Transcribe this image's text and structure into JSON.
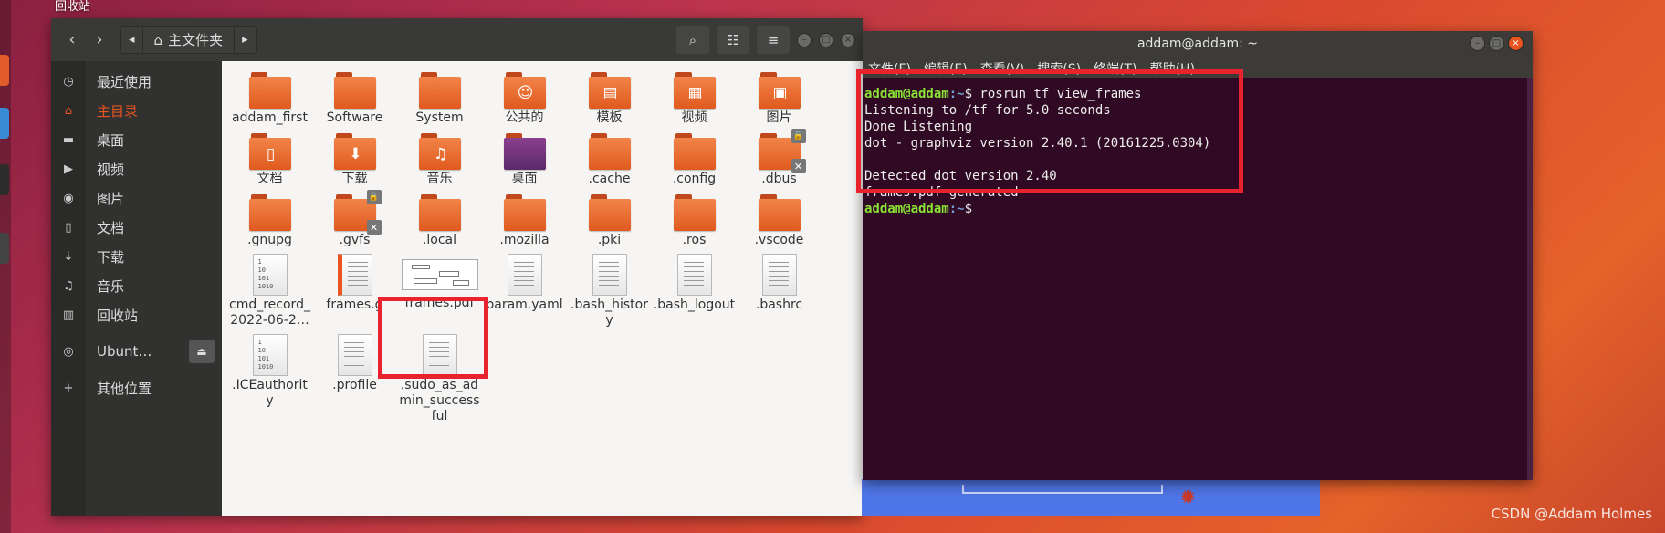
{
  "desktop": {
    "trash_label": "回收站",
    "watermark": "CSDN @Addam Holmes"
  },
  "file_manager": {
    "path_home": "主文件夹",
    "sidebar": [
      {
        "icon": "clock-icon",
        "glyph": "◷",
        "label": "最近使用"
      },
      {
        "icon": "home-icon",
        "glyph": "⌂",
        "label": "主目录",
        "active": true
      },
      {
        "icon": "folder-icon",
        "glyph": "▬",
        "label": "桌面"
      },
      {
        "icon": "video-icon",
        "glyph": "▶",
        "label": "视频"
      },
      {
        "icon": "camera-icon",
        "glyph": "◉",
        "label": "图片"
      },
      {
        "icon": "document-icon",
        "glyph": "▯",
        "label": "文档"
      },
      {
        "icon": "download-icon",
        "glyph": "⇣",
        "label": "下载"
      },
      {
        "icon": "music-icon",
        "glyph": "♫",
        "label": "音乐"
      },
      {
        "icon": "trash-icon",
        "glyph": "▥",
        "label": "回收站"
      },
      {
        "icon": "disc-icon",
        "glyph": "◎",
        "label": "Ubunt…",
        "eject": "⏏"
      },
      {
        "icon": "plus-icon",
        "glyph": "+",
        "label": "其他位置"
      }
    ],
    "files": [
      {
        "name": "addam_first",
        "kind": "folder"
      },
      {
        "name": "Software",
        "kind": "folder"
      },
      {
        "name": "System",
        "kind": "folder"
      },
      {
        "name": "公共的",
        "kind": "folder",
        "emblem": "☺"
      },
      {
        "name": "模板",
        "kind": "folder",
        "emblem": "▤"
      },
      {
        "name": "视频",
        "kind": "folder",
        "emblem": "▦"
      },
      {
        "name": "图片",
        "kind": "folder",
        "emblem": "▣"
      },
      {
        "name": "文档",
        "kind": "folder",
        "emblem": "▯"
      },
      {
        "name": "下载",
        "kind": "folder",
        "emblem": "⬇"
      },
      {
        "name": "音乐",
        "kind": "folder",
        "emblem": "♫"
      },
      {
        "name": "桌面",
        "kind": "folder-purple"
      },
      {
        "name": ".cache",
        "kind": "folder"
      },
      {
        "name": ".config",
        "kind": "folder"
      },
      {
        "name": ".dbus",
        "kind": "folder",
        "badge": "🔒",
        "badge2": "✕"
      },
      {
        "name": ".gnupg",
        "kind": "folder"
      },
      {
        "name": ".gvfs",
        "kind": "folder",
        "badge": "🔒",
        "badge2": "✕"
      },
      {
        "name": ".local",
        "kind": "folder"
      },
      {
        "name": ".mozilla",
        "kind": "folder"
      },
      {
        "name": ".pki",
        "kind": "folder"
      },
      {
        "name": ".ros",
        "kind": "folder"
      },
      {
        "name": ".vscode",
        "kind": "folder"
      },
      {
        "name": "cmd_record_2022-06-2…",
        "kind": "binary"
      },
      {
        "name": "frames.g",
        "kind": "doc-orange"
      },
      {
        "name": "frames.pdf",
        "kind": "pdf"
      },
      {
        "name": "param.yaml",
        "kind": "doc"
      },
      {
        "name": ".bash_history",
        "kind": "doc"
      },
      {
        "name": ".bash_logout",
        "kind": "doc"
      },
      {
        "name": ".bashrc",
        "kind": "doc"
      },
      {
        "name": ".ICEauthority",
        "kind": "binary"
      },
      {
        "name": ".profile",
        "kind": "doc"
      },
      {
        "name": ".sudo_as_admin_successful",
        "kind": "doc"
      }
    ],
    "binary_text": "1\n10\n101\n1010"
  },
  "terminal": {
    "title": "addam@addam: ~",
    "menu": [
      "文件(F)",
      "编辑(E)",
      "查看(V)",
      "搜索(S)",
      "终端(T)",
      "帮助(H)"
    ],
    "prompt_user": "addam@addam",
    "prompt_path": ":~",
    "command": "$ rosrun tf view_frames",
    "output": [
      "Listening to /tf for 5.0 seconds",
      "Done Listening",
      "dot - graphviz version 2.40.1 (20161225.0304)",
      "",
      "Detected dot version 2.40",
      "frames.pdf generated"
    ],
    "prompt_end": "$"
  },
  "colors": {
    "accent": "#e95420",
    "highlight": "#e8232e",
    "terminal_bg": "#300a24",
    "prompt_user": "#8ae234",
    "prompt_path": "#729fcf"
  }
}
